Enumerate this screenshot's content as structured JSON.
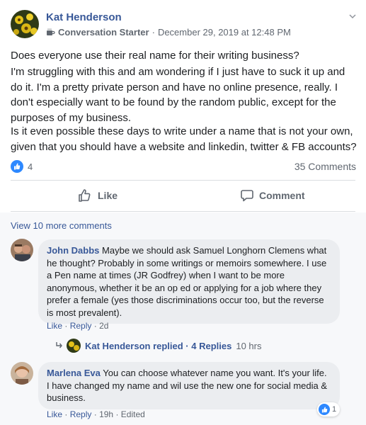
{
  "post": {
    "author": "Kat Henderson",
    "badge": "Conversation Starter",
    "timestamp": "December 29, 2019 at 12:48 PM",
    "paragraphs": [
      "Does everyone use their real name for their writing business?",
      "I'm struggling with this and am wondering if I just have to suck it up and do it. I'm a pretty private person and have no online presence, really. I don't especially want to be found by the random public, except for the purposes of my business.",
      "Is it even possible these days to write under a name that is not your own, given that you should have a website and linkedin, twitter & FB accounts?"
    ],
    "reaction_count": "4",
    "comment_count": "35 Comments"
  },
  "actions": {
    "like_label": "Like",
    "comment_label": "Comment"
  },
  "comments_section": {
    "view_more": "View 10 more comments"
  },
  "comments": [
    {
      "author": "John Dabbs",
      "text": "Maybe we should ask Samuel Longhorn Clemens what he thought? Probably in some writings or memoirs somewhere. I use a Pen name at times (JR Godfrey) when I want to be more anonymous, whether it be an op ed or applying for a job where they prefer a female (yes those discriminations occur too, but the reverse is most prevalent).",
      "like": "Like",
      "reply": "Reply",
      "age": "2d"
    },
    {
      "author": "Marlena Eva",
      "text": "You can choose whatever name you want. It's your life. I have changed my name and wil use the new one for social media & business.",
      "like": "Like",
      "reply": "Reply",
      "age": "19h",
      "edited": "Edited",
      "reaction_count": "1"
    }
  ],
  "reply_thread": {
    "text": "Kat Henderson replied · 4 Replies",
    "age": "10 hrs"
  },
  "icons": {
    "badge_icon": "coffee-cup-icon",
    "options": "chevron-down-icon",
    "like": "thumbs-up-icon",
    "comment": "speech-bubble-icon",
    "reply_arrow": "reply-arrow-icon"
  },
  "colors": {
    "link": "#385898",
    "reaction_blue": "#2d88ff",
    "bubble": "#ebedf0",
    "muted": "#606770"
  }
}
